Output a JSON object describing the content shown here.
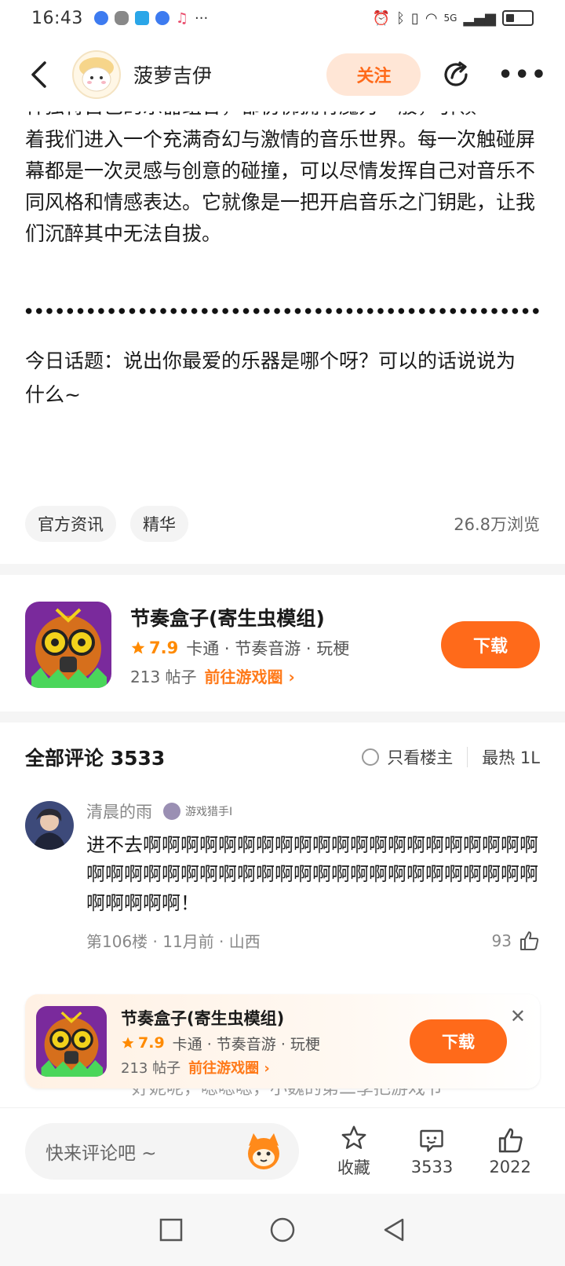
{
  "status": {
    "time": "16:43",
    "network": "5G"
  },
  "header": {
    "author": "菠萝吉伊",
    "follow_label": "关注"
  },
  "article": {
    "cut_line": "种独特自己的乐器组合，都仿佛拥有魔力一般，引领",
    "paragraph": "着我们进入一个充满奇幻与激情的音乐世界。每一次触碰屏幕都是一次灵感与创意的碰撞，可以尽情发挥自己对音乐不同风格和情感表达。它就像是一把开启音乐之门钥匙，让我们沉醉其中无法自拔。",
    "topic": "今日话题：说出你最爱的乐器是哪个呀？可以的话说说为什么~"
  },
  "tags": {
    "items": [
      "官方资讯",
      "精华"
    ],
    "views": "26.8万浏览"
  },
  "game": {
    "title": "节奏盒子(寄生虫模组)",
    "rating": "7.9",
    "tags_text": "卡通 · 节奏音游 · 玩梗",
    "posts": "213 帖子",
    "circle_link": "前往游戏圈 ›",
    "download_label": "下载"
  },
  "comments": {
    "title": "全部评论 3533",
    "only_op_label": "只看楼主",
    "sort_label": "最热 1L",
    "items": [
      {
        "user": "清晨的雨",
        "badge": "游戏猎手I",
        "text": "进不去啊啊啊啊啊啊啊啊啊啊啊啊啊啊啊啊啊啊啊啊啊啊啊啊啊啊啊啊啊啊啊啊啊啊啊啊啊啊啊啊啊啊啊啊啊啊啊啊啊啊！",
        "meta": "第106楼 · 11月前 · 山西",
        "likes": "93"
      }
    ],
    "peek_text": "好妮呢，嗯嗯嗯，小魏的第二季把游戏节"
  },
  "bottom": {
    "input_placeholder": "快来评论吧 ~",
    "collect_label": "收藏",
    "comment_count": "3533",
    "like_count": "2022"
  },
  "colors": {
    "accent": "#ff6a1a",
    "follow_bg": "#ffe6d6",
    "rating": "#ff8a00"
  }
}
